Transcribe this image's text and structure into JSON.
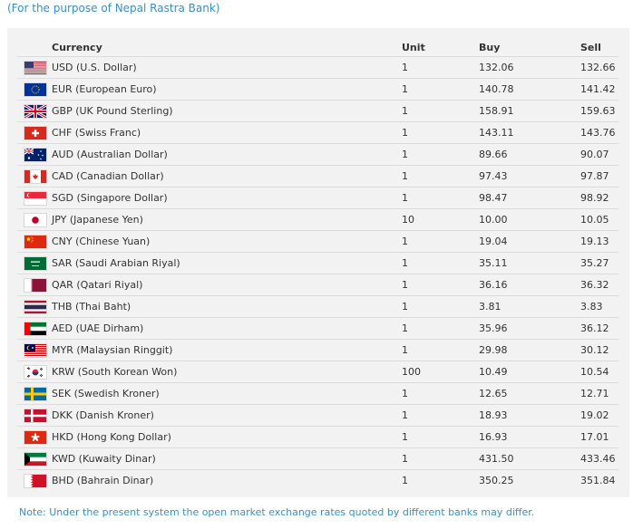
{
  "subtitle": "(For the purpose of Nepal Rastra Bank)",
  "table": {
    "headers": {
      "currency": "Currency",
      "unit": "Unit",
      "buy": "Buy",
      "sell": "Sell"
    },
    "rows": [
      {
        "code": "USD",
        "name": "USD (U.S. Dollar)",
        "unit": "1",
        "buy": "132.06",
        "sell": "132.66",
        "flag_icon": "us-flag-icon"
      },
      {
        "code": "EUR",
        "name": "EUR (European Euro)",
        "unit": "1",
        "buy": "140.78",
        "sell": "141.42",
        "flag_icon": "eu-flag-icon"
      },
      {
        "code": "GBP",
        "name": "GBP (UK Pound Sterling)",
        "unit": "1",
        "buy": "158.91",
        "sell": "159.63",
        "flag_icon": "uk-flag-icon"
      },
      {
        "code": "CHF",
        "name": "CHF (Swiss Franc)",
        "unit": "1",
        "buy": "143.11",
        "sell": "143.76",
        "flag_icon": "switzerland-flag-icon"
      },
      {
        "code": "AUD",
        "name": "AUD (Australian Dollar)",
        "unit": "1",
        "buy": "89.66",
        "sell": "90.07",
        "flag_icon": "australia-flag-icon"
      },
      {
        "code": "CAD",
        "name": "CAD (Canadian Dollar)",
        "unit": "1",
        "buy": "97.43",
        "sell": "97.87",
        "flag_icon": "canada-flag-icon"
      },
      {
        "code": "SGD",
        "name": "SGD (Singapore Dollar)",
        "unit": "1",
        "buy": "98.47",
        "sell": "98.92",
        "flag_icon": "singapore-flag-icon"
      },
      {
        "code": "JPY",
        "name": "JPY (Japanese Yen)",
        "unit": "10",
        "buy": "10.00",
        "sell": "10.05",
        "flag_icon": "japan-flag-icon"
      },
      {
        "code": "CNY",
        "name": "CNY (Chinese Yuan)",
        "unit": "1",
        "buy": "19.04",
        "sell": "19.13",
        "flag_icon": "china-flag-icon"
      },
      {
        "code": "SAR",
        "name": "SAR (Saudi Arabian Riyal)",
        "unit": "1",
        "buy": "35.11",
        "sell": "35.27",
        "flag_icon": "saudi-arabia-flag-icon"
      },
      {
        "code": "QAR",
        "name": "QAR (Qatari Riyal)",
        "unit": "1",
        "buy": "36.16",
        "sell": "36.32",
        "flag_icon": "qatar-flag-icon"
      },
      {
        "code": "THB",
        "name": "THB (Thai Baht)",
        "unit": "1",
        "buy": "3.81",
        "sell": "3.83",
        "flag_icon": "thailand-flag-icon"
      },
      {
        "code": "AED",
        "name": "AED (UAE Dirham)",
        "unit": "1",
        "buy": "35.96",
        "sell": "36.12",
        "flag_icon": "uae-flag-icon"
      },
      {
        "code": "MYR",
        "name": "MYR (Malaysian Ringgit)",
        "unit": "1",
        "buy": "29.98",
        "sell": "30.12",
        "flag_icon": "malaysia-flag-icon"
      },
      {
        "code": "KRW",
        "name": "KRW (South Korean Won)",
        "unit": "100",
        "buy": "10.49",
        "sell": "10.54",
        "flag_icon": "south-korea-flag-icon"
      },
      {
        "code": "SEK",
        "name": "SEK (Swedish Kroner)",
        "unit": "1",
        "buy": "12.65",
        "sell": "12.71",
        "flag_icon": "sweden-flag-icon"
      },
      {
        "code": "DKK",
        "name": "DKK (Danish Kroner)",
        "unit": "1",
        "buy": "18.93",
        "sell": "19.02",
        "flag_icon": "denmark-flag-icon"
      },
      {
        "code": "HKD",
        "name": "HKD (Hong Kong Dollar)",
        "unit": "1",
        "buy": "16.93",
        "sell": "17.01",
        "flag_icon": "hong-kong-flag-icon"
      },
      {
        "code": "KWD",
        "name": "KWD (Kuwaity Dinar)",
        "unit": "1",
        "buy": "431.50",
        "sell": "433.46",
        "flag_icon": "kuwait-flag-icon"
      },
      {
        "code": "BHD",
        "name": "BHD (Bahrain Dinar)",
        "unit": "1",
        "buy": "350.25",
        "sell": "351.84",
        "flag_icon": "bahrain-flag-icon"
      }
    ]
  },
  "note": "Note: Under the present system the open market exchange rates quoted by different banks may differ.",
  "colors": {
    "accent": "#3b8fc4",
    "panel": "#f2f2f2",
    "row_border": "#dddddd"
  }
}
